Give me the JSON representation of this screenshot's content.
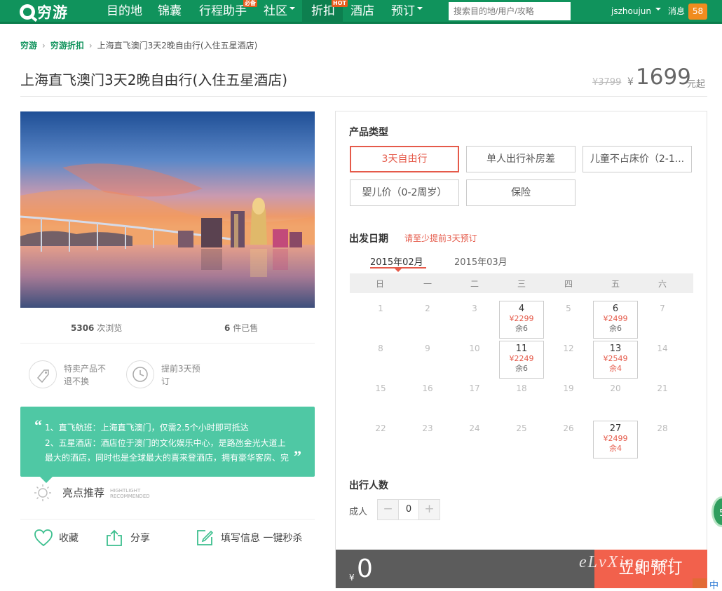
{
  "nav": {
    "logo": "穷游",
    "items": [
      {
        "label": "目的地"
      },
      {
        "label": "锦囊"
      },
      {
        "label": "行程助手",
        "badge": "必备"
      },
      {
        "label": "社区"
      },
      {
        "label": "折扣",
        "badge": "HOT"
      },
      {
        "label": "酒店"
      },
      {
        "label": "预订"
      }
    ],
    "search_placeholder": "搜索目的地/用户/攻略",
    "username": "jszhoujun",
    "messages_label": "消息",
    "messages_count": "58"
  },
  "breadcrumb": [
    "穷游",
    "穷游折扣",
    "上海直飞澳门3天2晚自由行(入住五星酒店)"
  ],
  "product": {
    "title": "上海直飞澳门3天2晚自由行(入住五星酒店)",
    "original_price": "¥3799",
    "currency": "¥",
    "price": "1699",
    "price_suffix": "元起"
  },
  "stats": {
    "views_value": "5306",
    "views_label": "次浏览",
    "sold_value": "6",
    "sold_label": "件已售"
  },
  "features": [
    {
      "text": "特卖产品不退不换",
      "icon": "tag-icon"
    },
    {
      "text": "提前3天预订",
      "icon": "clock-icon"
    }
  ],
  "highlights": {
    "open_quote": "“",
    "close_quote": "”",
    "lines": [
      "1、直飞航班：上海直飞澳门，仅需2.5个小时即可抵达",
      "2、五星酒店：酒店位于澳门的文化娱乐中心，是路氹金光大道上",
      "最大的酒店，同时也是全球最大的喜来登酒店，拥有豪华客房、完"
    ],
    "label": "亮点推荐",
    "label_en_1": "HIGHTLIGHT",
    "label_en_2": "RECOMMENDED"
  },
  "actions": [
    {
      "label": "收藏",
      "icon": "heart-icon"
    },
    {
      "label": "分享",
      "icon": "share-icon"
    },
    {
      "label": "填写信息 一键秒杀",
      "icon": "edit-icon"
    }
  ],
  "booking": {
    "product_type_label": "产品类型",
    "product_types": [
      "3天自由行",
      "单人出行补房差",
      "儿童不占床价（2-1...",
      "婴儿价（0-2周岁）",
      "保险"
    ],
    "selected_type": "3天自由行",
    "date_label": "出发日期",
    "date_hint": "请至少提前3天预订",
    "months": [
      "2015年02月",
      "2015年03月"
    ],
    "selected_month": "2015年02月",
    "weekdays": [
      "日",
      "一",
      "二",
      "三",
      "四",
      "五",
      "六"
    ],
    "weeks": [
      [
        {
          "d": "1"
        },
        {
          "d": "2"
        },
        {
          "d": "3"
        },
        {
          "d": "4",
          "p": "¥2299",
          "r": "余6"
        },
        {
          "d": "5"
        },
        {
          "d": "6",
          "p": "¥2499",
          "r": "余6"
        },
        {
          "d": "7"
        }
      ],
      [
        {
          "d": "8"
        },
        {
          "d": "9"
        },
        {
          "d": "10"
        },
        {
          "d": "11",
          "p": "¥2249",
          "r": "余6"
        },
        {
          "d": "12"
        },
        {
          "d": "13",
          "p": "¥2549",
          "r": "余4",
          "low": true
        },
        {
          "d": "14"
        }
      ],
      [
        {
          "d": "15"
        },
        {
          "d": "16"
        },
        {
          "d": "17"
        },
        {
          "d": "18"
        },
        {
          "d": "19"
        },
        {
          "d": "20"
        },
        {
          "d": "21"
        }
      ],
      [
        {
          "d": "22"
        },
        {
          "d": "23"
        },
        {
          "d": "24"
        },
        {
          "d": "25"
        },
        {
          "d": "26"
        },
        {
          "d": "27",
          "p": "¥2499",
          "r": "余4",
          "low": true
        },
        {
          "d": "28"
        }
      ]
    ],
    "travelers_label": "出行人数",
    "adult_label": "成人",
    "adult_count": "0",
    "minus": "−",
    "plus": "+",
    "total_currency": "¥",
    "total": "0",
    "book_button": "立即预订"
  },
  "watermark": "eLvXing.net",
  "floating_badge": "5",
  "corner_text": "中",
  "colors": {
    "brand_green": "#10935c",
    "accent_red": "#e55a4a",
    "highlight_teal": "#4fc8a4",
    "book_button": "#f2614c"
  }
}
